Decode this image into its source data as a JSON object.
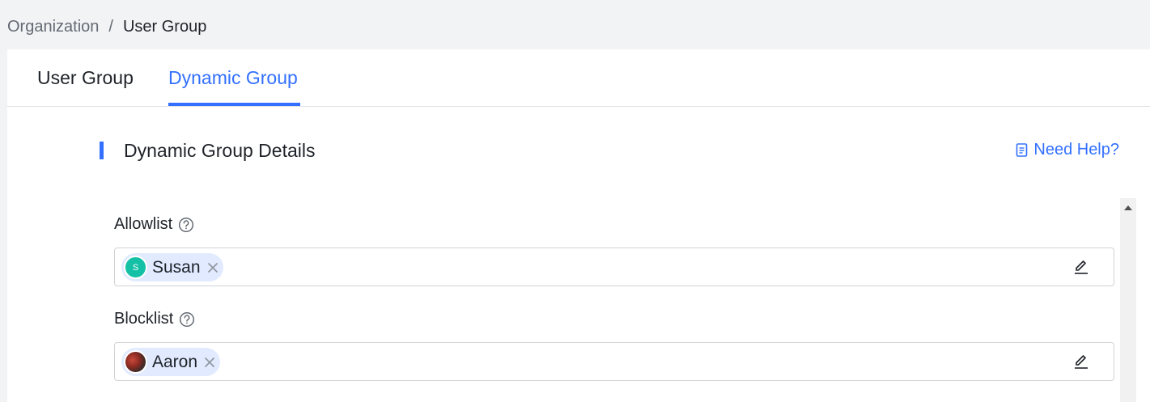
{
  "breadcrumb": {
    "parent": "Organization",
    "separator": "/",
    "current": "User Group"
  },
  "tabs": [
    {
      "label": "User Group",
      "active": false
    },
    {
      "label": "Dynamic Group",
      "active": true
    }
  ],
  "section": {
    "title": "Dynamic Group Details",
    "help_label": "Need Help?"
  },
  "allowlist": {
    "label": "Allowlist",
    "chips": [
      {
        "name": "Susan",
        "avatar_initial": "S",
        "avatar_color": "#14c0a6"
      }
    ]
  },
  "blocklist": {
    "label": "Blocklist",
    "chips": [
      {
        "name": "Aaron",
        "avatar": "photo"
      }
    ]
  },
  "colors": {
    "accent": "#3370ff",
    "chip_bg": "#e1eaff"
  },
  "icons": {
    "help": "document-icon",
    "question": "question-circle-icon",
    "remove": "close-icon",
    "edit": "pencil-icon",
    "scroll": "scroll-up-arrow-icon"
  }
}
